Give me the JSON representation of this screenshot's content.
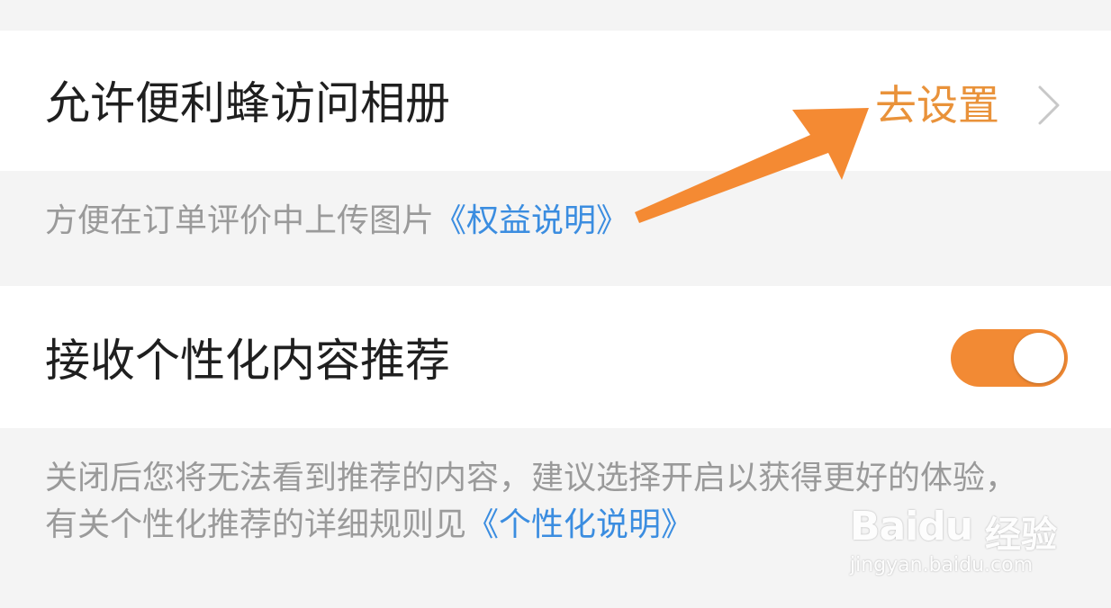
{
  "album_permission": {
    "title": "允许便利蜂访问相册",
    "action_label": "去设置",
    "description": "方便在订单评价中上传图片",
    "link": "《权益说明》"
  },
  "recommendation": {
    "title": "接收个性化内容推荐",
    "toggle_on": true,
    "description_line1": "关闭后您将无法看到推荐的内容，建议选择开启以获得更好的体验，",
    "description_line2": "有关个性化推荐的详细规则见",
    "link": "《个性化说明》"
  },
  "watermark": {
    "brand": "Baidu",
    "brand_cn": "经验",
    "url": "jingyan.baidu.com"
  },
  "colors": {
    "accent": "#f28a34",
    "link": "#3b8de0",
    "action_text": "#e9923a",
    "arrow": "#f48a33"
  },
  "icons": {
    "action_chevron": "chevron-right-icon",
    "annotation": "arrow-annotation-icon"
  }
}
